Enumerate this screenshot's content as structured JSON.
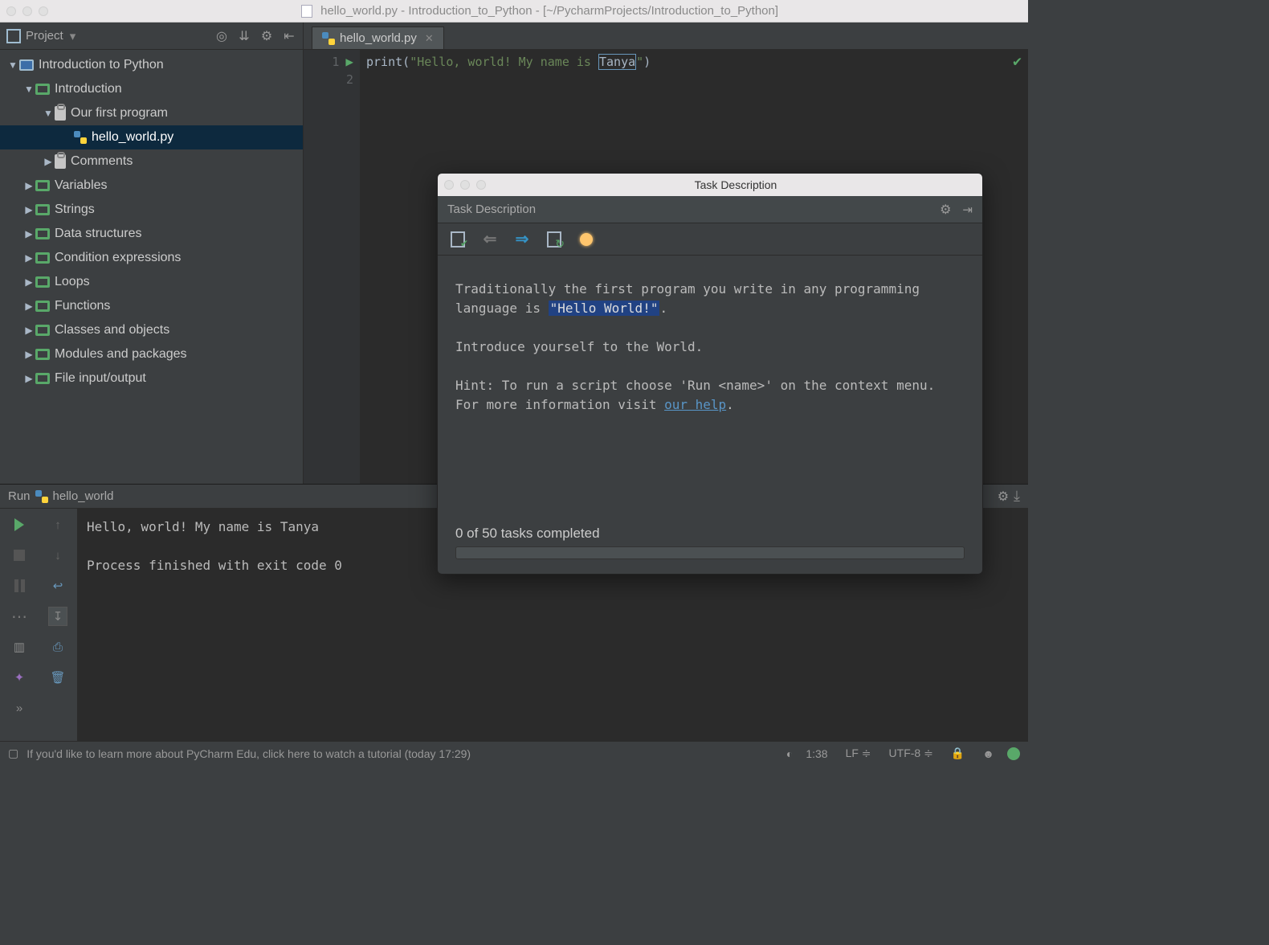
{
  "window": {
    "title": "hello_world.py - Introduction_to_Python - [~/PycharmProjects/Introduction_to_Python]"
  },
  "project_tool": {
    "label": "Project"
  },
  "editor_tab": {
    "filename": "hello_world.py"
  },
  "tree": {
    "root": "Introduction to Python",
    "intro": "Introduction",
    "first_prog": "Our first program",
    "hello_file": "hello_world.py",
    "comments": "Comments",
    "variables": "Variables",
    "strings": "Strings",
    "data_structures": "Data structures",
    "condition": "Condition expressions",
    "loops": "Loops",
    "functions": "Functions",
    "classes": "Classes and objects",
    "modules": "Modules and packages",
    "fileio": "File input/output"
  },
  "code": {
    "line1_a": "print(",
    "line1_b": "\"Hello, world! My name is ",
    "line1_sel": "Tanya",
    "line1_c": "\"",
    "line1_d": ")",
    "gutter1": "1",
    "gutter2": "2"
  },
  "run": {
    "tab_label": "Run",
    "config_name": "hello_world",
    "output_line1": "Hello, world! My name is Tanya",
    "output_line2": "Process finished with exit code 0"
  },
  "task": {
    "win_title": "Task Description",
    "panel_label": "Task Description",
    "body_p1": "Traditionally the first program you write in any programming language is ",
    "body_hl": "\"Hello World!\"",
    "body_p1_end": ".",
    "body_p2": "Introduce yourself to the World.",
    "body_p3a": "Hint: To run a script choose 'Run <name>' on the context menu.",
    "body_p3b": "For more information visit ",
    "body_link": "our help",
    "body_p3c": ".",
    "progress": "0 of 50 tasks completed"
  },
  "status": {
    "message": "If you'd like to learn more about PyCharm Edu, click here to watch a tutorial (today 17:29)",
    "cursor": "1:38",
    "line_sep": "LF",
    "encoding": "UTF-8"
  }
}
